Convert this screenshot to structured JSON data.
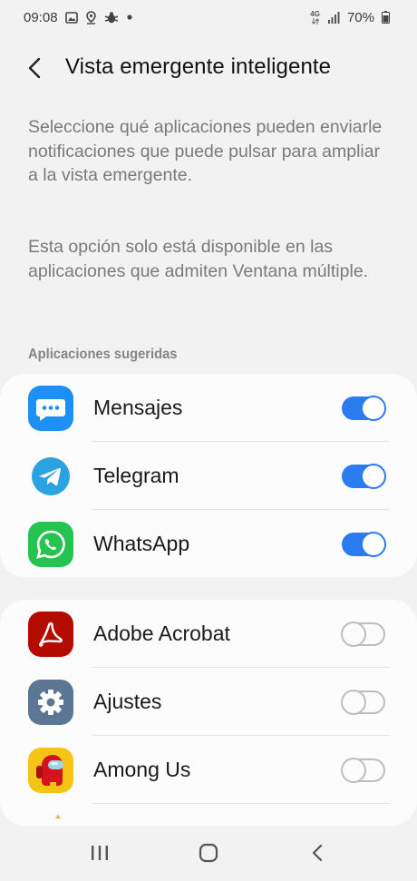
{
  "status_bar": {
    "time": "09:08",
    "network": "4G",
    "battery": "70%",
    "notification_icons": [
      "image-icon",
      "location-icon",
      "bug-icon",
      "dot-icon"
    ]
  },
  "header": {
    "title": "Vista emergente inteligente"
  },
  "description": {
    "paragraph1": "Seleccione qué aplicaciones pueden enviarle notificaciones que puede pulsar para ampliar a la vista emergente.",
    "paragraph2": "Esta opción solo está disponible en las aplicaciones que admiten Ventana múltiple."
  },
  "suggested": {
    "label": "Aplicaciones sugeridas",
    "apps": [
      {
        "name": "Mensajes",
        "icon": "messages-icon",
        "enabled": true
      },
      {
        "name": "Telegram",
        "icon": "telegram-icon",
        "enabled": true
      },
      {
        "name": "WhatsApp",
        "icon": "whatsapp-icon",
        "enabled": true
      }
    ]
  },
  "other": {
    "apps": [
      {
        "name": "Adobe Acrobat",
        "icon": "adobe-acrobat-icon",
        "enabled": false
      },
      {
        "name": "Ajustes",
        "icon": "settings-gear-icon",
        "enabled": false
      },
      {
        "name": "Among Us",
        "icon": "among-us-icon",
        "enabled": false
      }
    ]
  },
  "colors": {
    "accent": "#2a7cf0",
    "background": "#f2f2f2",
    "card": "#fcfcfc"
  }
}
